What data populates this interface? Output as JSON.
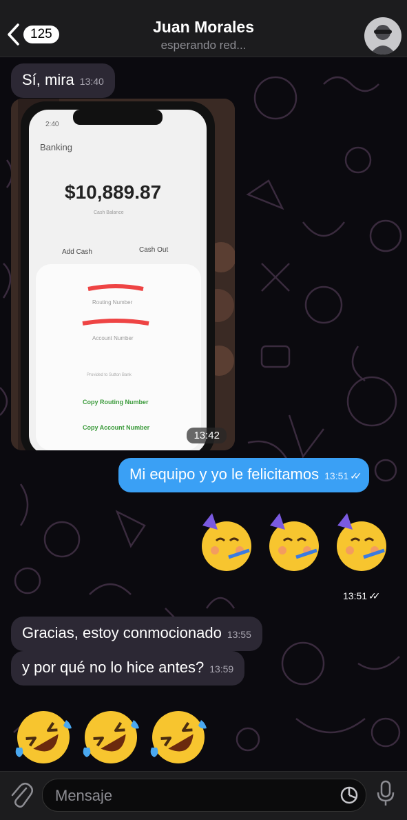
{
  "header": {
    "back_count": "125",
    "contact_name": "Juan Morales",
    "status": "esperando red..."
  },
  "messages": {
    "m1": {
      "text": "Sí, mira",
      "time": "13:40"
    },
    "photo": {
      "time": "13:42",
      "screen": {
        "status_time": "2:40",
        "app_title": "Banking",
        "balance": "$10,889.87",
        "balance_label": "Cash Balance",
        "add_cash": "Add Cash",
        "cash_out": "Cash Out",
        "routing_label": "Routing Number",
        "account_label": "Account Number",
        "provided_by": "Provided to Sutton Bank",
        "copy_routing": "Copy Routing Number",
        "copy_account": "Copy Account Number"
      }
    },
    "m2": {
      "text": "Mi equipo y yo le felicitamos",
      "time": "13:51"
    },
    "emoji_party_time": "13:51",
    "m3": {
      "text": "Gracias, estoy conmocionado",
      "time": "13:55"
    },
    "m4": {
      "text": "y por qué no lo hice antes?",
      "time": "13:59"
    }
  },
  "input": {
    "placeholder": "Mensaje"
  },
  "colors": {
    "outgoing_bubble": "#3aa0f5",
    "incoming_bubble": "#2c2834",
    "header": "#1c1c1e"
  }
}
